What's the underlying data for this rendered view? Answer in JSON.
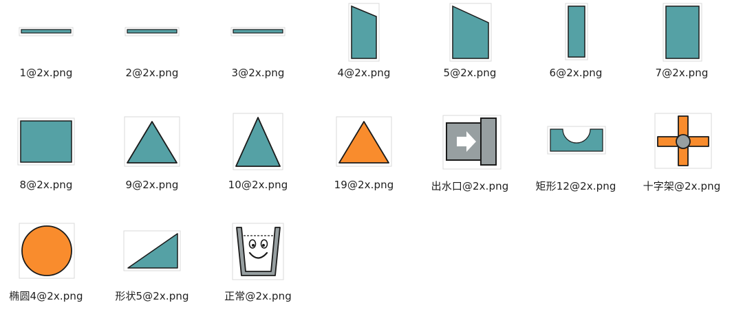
{
  "window": {
    "view": "icon-view"
  },
  "colors": {
    "teal": "#55a1a5",
    "orange": "#f98c2d",
    "grey": "#979fa1",
    "outline": "#1a1a1a",
    "frame": "#d9d9d9"
  },
  "files": [
    {
      "name": "1@2x.png",
      "icon": "thin-bar-icon"
    },
    {
      "name": "2@2x.png",
      "icon": "thin-bar-icon"
    },
    {
      "name": "3@2x.png",
      "icon": "thin-bar-icon"
    },
    {
      "name": "4@2x.png",
      "icon": "slanted-tall-panel-icon"
    },
    {
      "name": "5@2x.png",
      "icon": "slanted-wide-panel-icon"
    },
    {
      "name": "6@2x.png",
      "icon": "narrow-rectangle-icon"
    },
    {
      "name": "7@2x.png",
      "icon": "tall-rectangle-icon"
    },
    {
      "name": "8@2x.png",
      "icon": "square-icon"
    },
    {
      "name": "9@2x.png",
      "icon": "teal-triangle-icon"
    },
    {
      "name": "10@2x.png",
      "icon": "tall-teal-triangle-icon"
    },
    {
      "name": "19@2x.png",
      "icon": "orange-triangle-icon"
    },
    {
      "name": "出水口@2x.png",
      "icon": "outlet-arrow-icon"
    },
    {
      "name": "矩形12@2x.png",
      "icon": "rectangle-half-circle-cutout-icon"
    },
    {
      "name": "十字架@2x.png",
      "icon": "cross-icon"
    },
    {
      "name": "椭圆4@2x.png",
      "icon": "orange-circle-icon"
    },
    {
      "name": "形状5@2x.png",
      "icon": "right-triangle-icon"
    },
    {
      "name": "正常@2x.png",
      "icon": "smiling-cup-icon"
    }
  ]
}
